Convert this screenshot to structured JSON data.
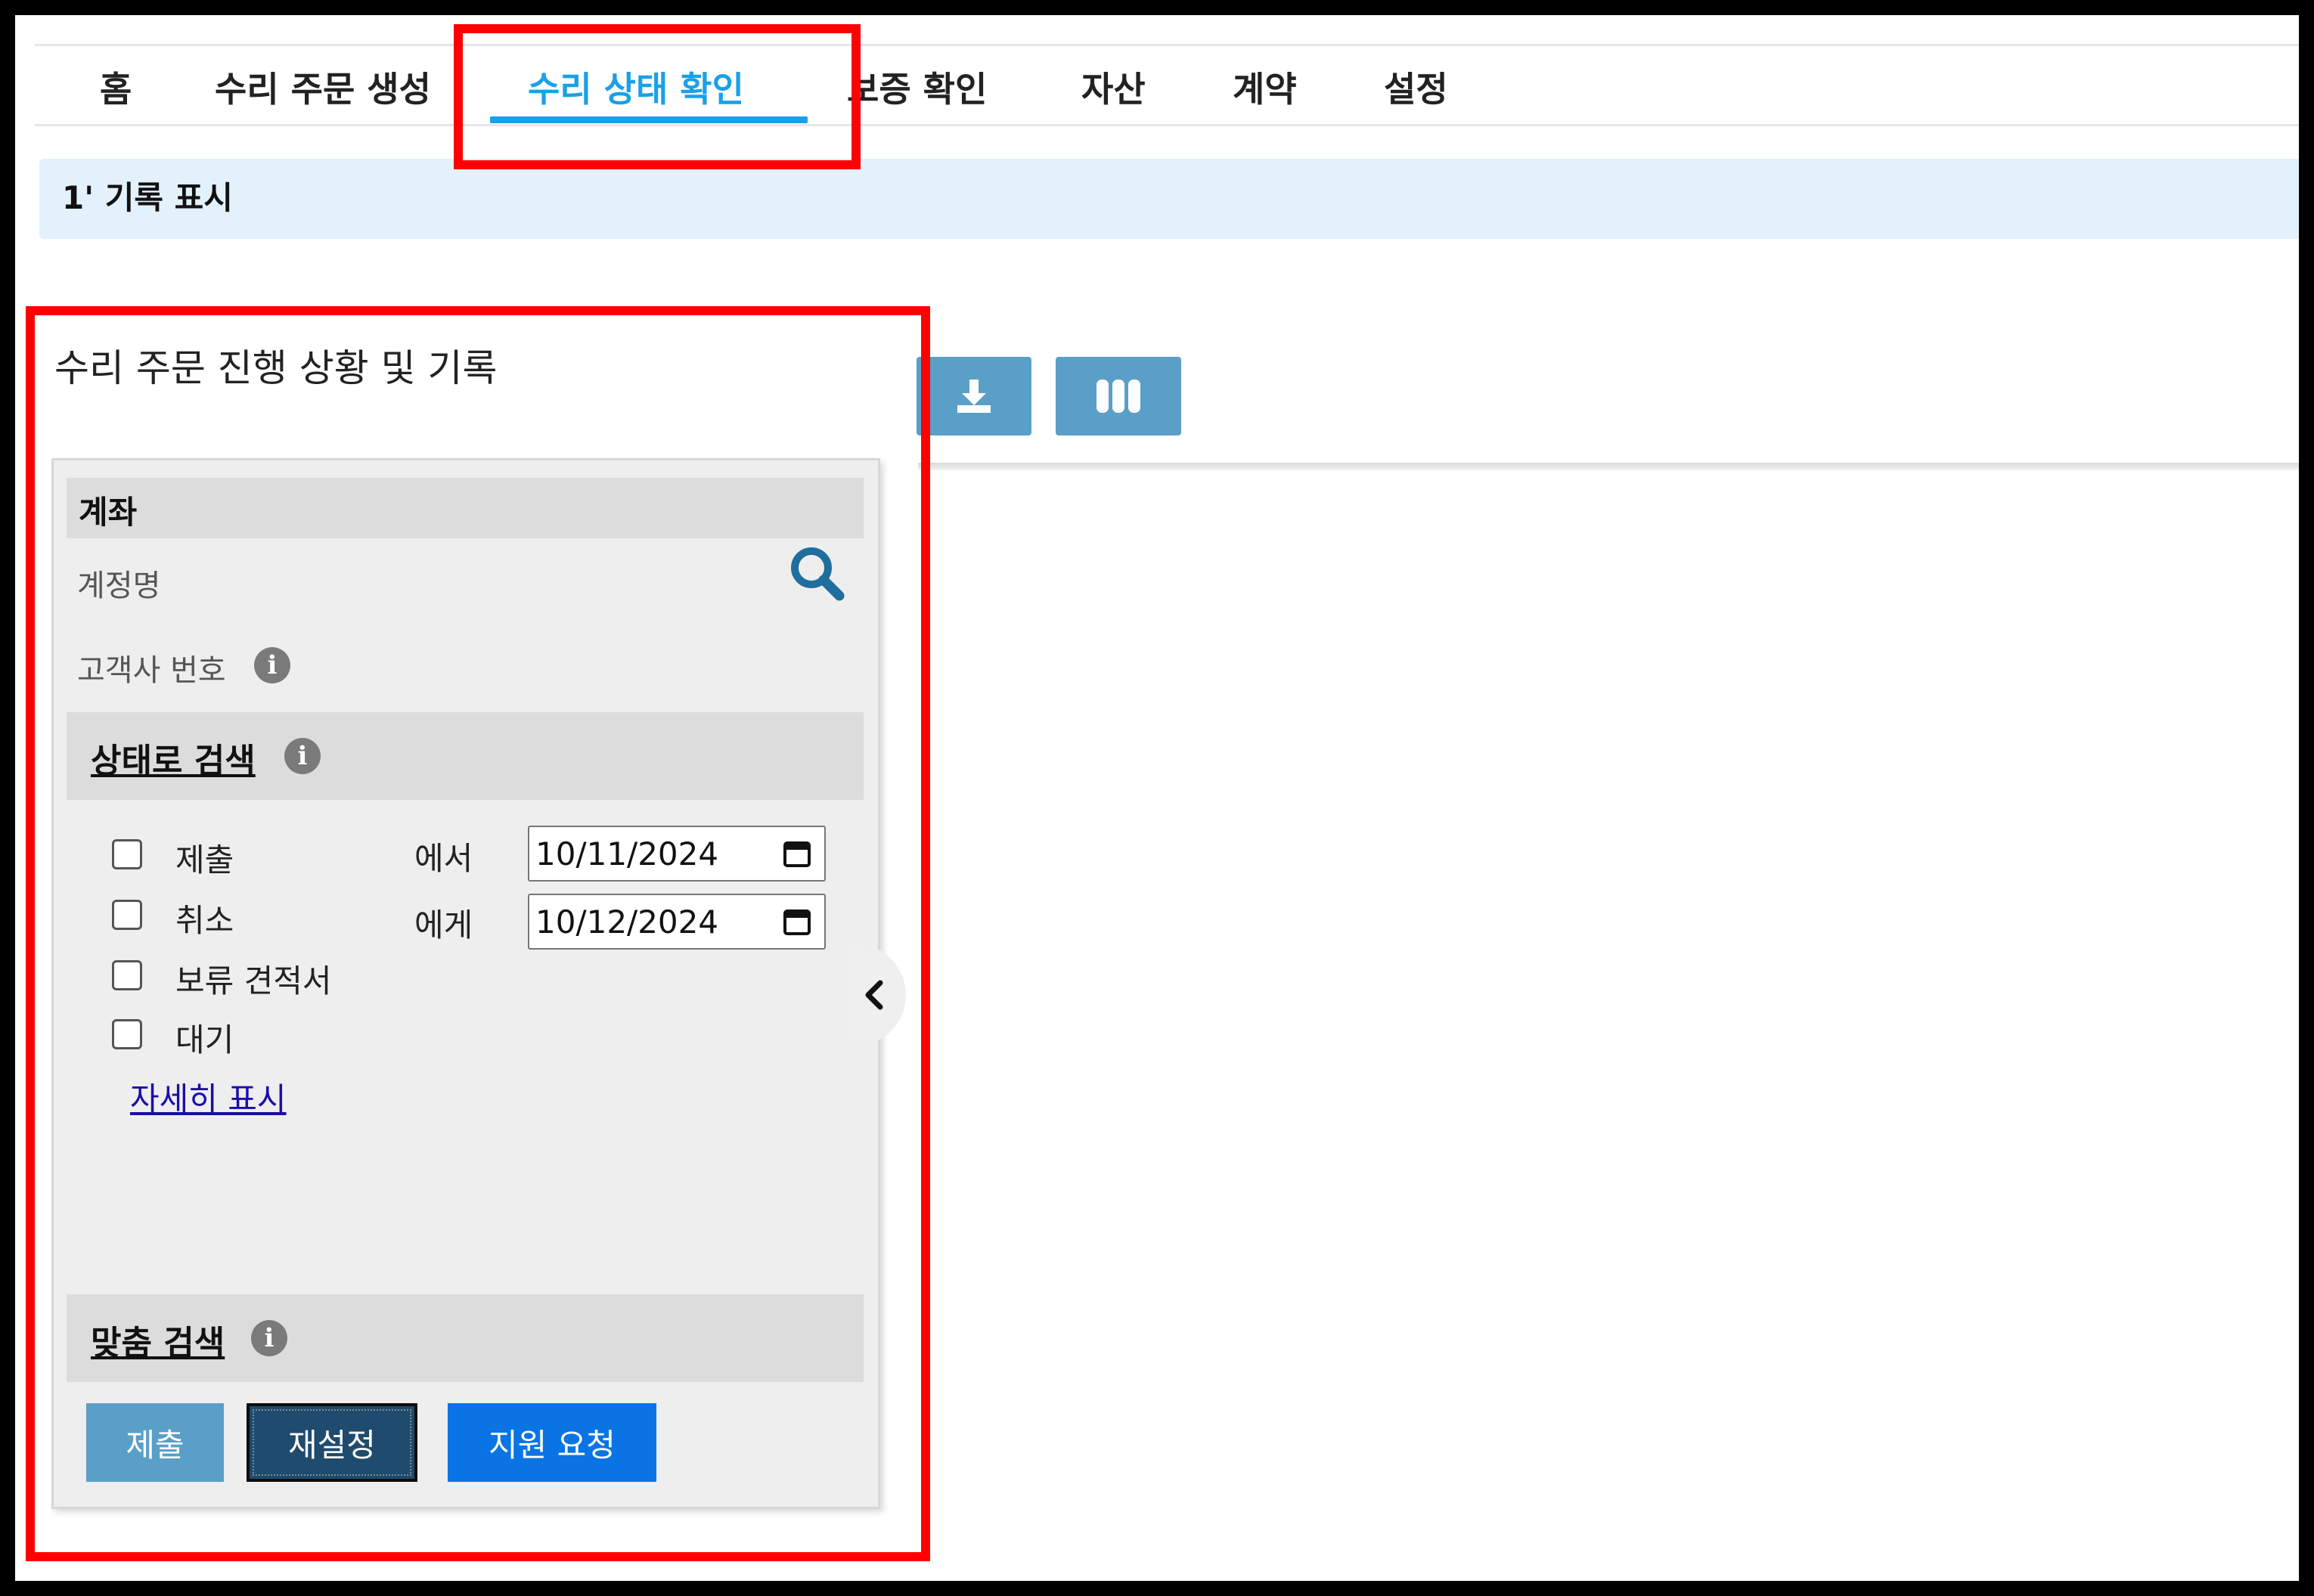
{
  "nav": {
    "tabs": [
      {
        "label": "홈"
      },
      {
        "label": "수리 주문 생성"
      },
      {
        "label": "수리 상태 확인"
      },
      {
        "label": "보증 확인"
      },
      {
        "label": "자산"
      },
      {
        "label": "계약"
      },
      {
        "label": "설정"
      }
    ],
    "active_index": 2
  },
  "info_bar": {
    "text": "1' 기록 표시"
  },
  "panel": {
    "title": "수리 주문 진행 상황 및 기록"
  },
  "toolbar": {
    "icons": [
      "download-icon",
      "columns-icon"
    ]
  },
  "filters": {
    "account": {
      "heading": "계좌",
      "account_name_label": "계정명",
      "customer_number_label": "고객사 번호"
    },
    "status": {
      "heading": "상태로 검색",
      "options": [
        {
          "label": "제출",
          "checked": false
        },
        {
          "label": "취소",
          "checked": false
        },
        {
          "label": "보류 견적서",
          "checked": false
        },
        {
          "label": "대기",
          "checked": false
        }
      ],
      "from_label": "에서",
      "to_label": "에게",
      "from_date": "10/11/2024",
      "to_date": "10/12/2024",
      "show_more": "자세히 표시"
    },
    "custom": {
      "heading": "맞춤 검색"
    },
    "buttons": {
      "submit": "제출",
      "reset": "재설정",
      "support": "지원 요청"
    }
  },
  "colors": {
    "accent": "#1aa0e8",
    "info_bar_bg": "#e2f1fc",
    "submit_bg": "#5a9fc8",
    "reset_bg": "#1e4b6e",
    "support_bg": "#0a74e4",
    "annotation": "#ff0000"
  }
}
